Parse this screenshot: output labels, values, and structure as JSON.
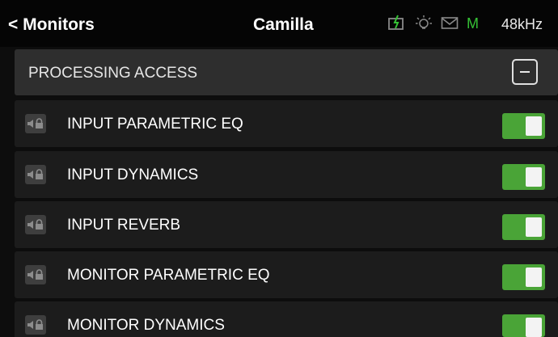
{
  "header": {
    "back_label": "< Monitors",
    "title": "Camilla",
    "indicators": [
      {
        "icon": "battery-charging-icon",
        "color": "#35c235"
      },
      {
        "icon": "lightbulb-icon",
        "color": "#8a8a8a"
      },
      {
        "icon": "mail-icon",
        "color": "#8a8a8a"
      },
      {
        "icon": "m-indicator",
        "label": "M",
        "color": "#35c235"
      }
    ],
    "sample_rate": "48kHz"
  },
  "section": {
    "label": "PROCESSING ACCESS",
    "collapse_icon": "minus-icon"
  },
  "rows": [
    {
      "label": "INPUT PARAMETRIC EQ",
      "enabled": true
    },
    {
      "label": "INPUT DYNAMICS",
      "enabled": true
    },
    {
      "label": "INPUT REVERB",
      "enabled": true
    },
    {
      "label": "MONITOR PARAMETRIC EQ",
      "enabled": true
    },
    {
      "label": "MONITOR DYNAMICS",
      "enabled": true
    }
  ],
  "colors": {
    "toggle_on": "#4aa437",
    "indicator_green": "#35c235",
    "background": "#0d0d0d",
    "row": "#1c1c1c",
    "section_header": "#2e2e2e"
  }
}
